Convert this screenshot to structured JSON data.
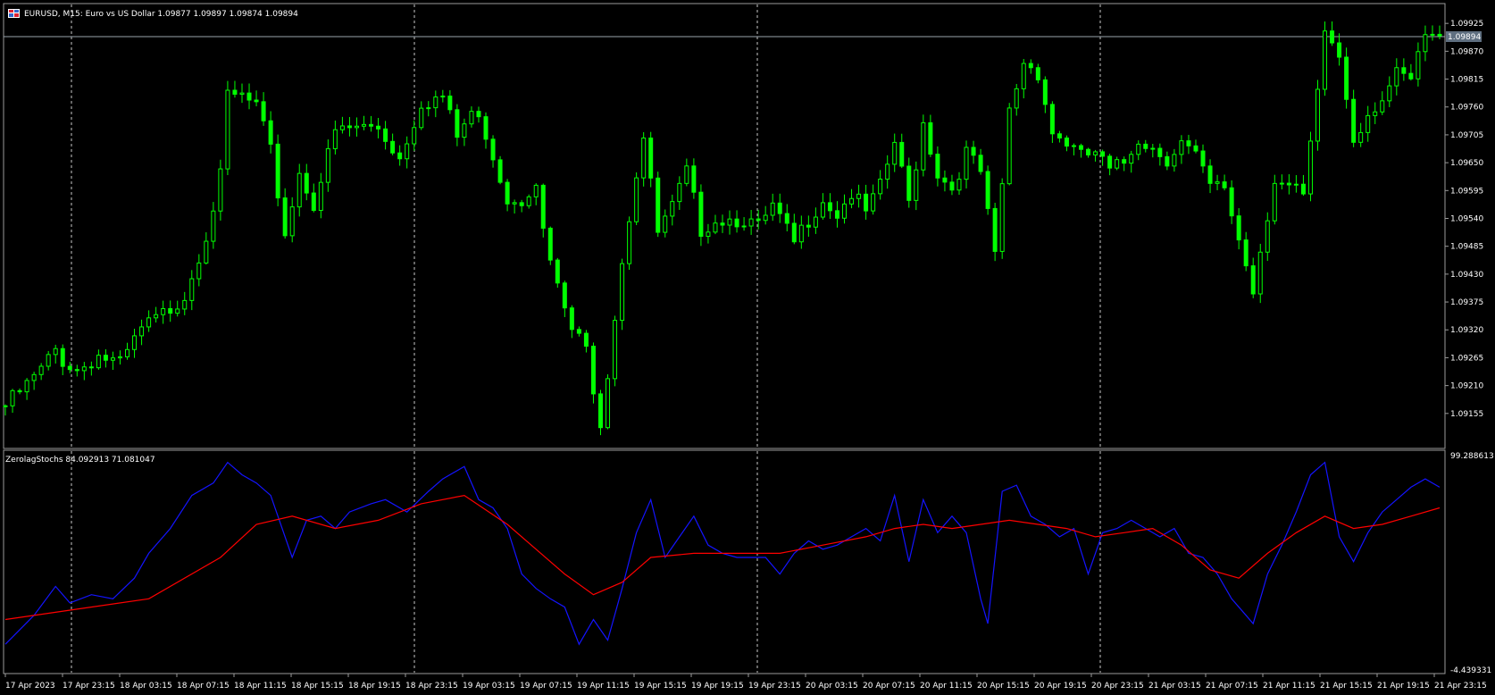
{
  "window": {
    "title": "EURUSD, M15:  Euro vs US Dollar  1.09877 1.09897 1.09874 1.09894",
    "indicator_title": "ZerolagStochs 84.092913 71.081047"
  },
  "colors": {
    "background": "#000000",
    "candle": "#00ff00",
    "grid": "#c8c8c8",
    "frame": "#9a9a9a",
    "bid_line": "#9aa3ad",
    "bid_label_bg": "#5f6f80",
    "stoch_main": "#1414ff",
    "stoch_signal": "#ff0000",
    "text": "#ffffff"
  },
  "icons": {
    "window_icon": "chart-window-icon"
  },
  "chart_data": [
    {
      "type": "candlestick",
      "symbol": "EURUSD",
      "timeframe": "M15",
      "ylim": [
        1.091,
        1.0995
      ],
      "y_ticks": [
        "1.09925",
        "1.09870",
        "1.09815",
        "1.09760",
        "1.09705",
        "1.09650",
        "1.09595",
        "1.09540",
        "1.09485",
        "1.09430",
        "1.09375",
        "1.09320",
        "1.09265",
        "1.09210",
        "1.09155"
      ],
      "current_price": "1.09894",
      "grid": "vertical-dashed",
      "x_ticks": [
        "17 Apr 2023",
        "17 Apr 23:15",
        "18 Apr 03:15",
        "18 Apr 07:15",
        "18 Apr 11:15",
        "18 Apr 15:15",
        "18 Apr 19:15",
        "18 Apr 23:15",
        "19 Apr 03:15",
        "19 Apr 07:15",
        "19 Apr 11:15",
        "19 Apr 15:15",
        "19 Apr 19:15",
        "19 Apr 23:15",
        "20 Apr 03:15",
        "20 Apr 07:15",
        "20 Apr 11:15",
        "20 Apr 15:15",
        "20 Apr 19:15",
        "20 Apr 23:15",
        "21 Apr 03:15",
        "21 Apr 07:15",
        "21 Apr 11:15",
        "21 Apr 15:15",
        "21 Apr 19:15",
        "21 Apr 23:15"
      ],
      "close_path": [
        [
          0,
          1.0917
        ],
        [
          3,
          1.0921
        ],
        [
          5,
          1.0924
        ],
        [
          7,
          1.0928
        ],
        [
          8,
          1.0926
        ],
        [
          10,
          1.0924
        ],
        [
          13,
          1.0927
        ],
        [
          16,
          1.0925
        ],
        [
          19,
          1.0932
        ],
        [
          22,
          1.0935
        ],
        [
          25,
          1.0939
        ],
        [
          28,
          1.0951
        ],
        [
          30,
          1.0962
        ],
        [
          31,
          1.0978
        ],
        [
          33,
          1.0978
        ],
        [
          35,
          1.0976
        ],
        [
          37,
          1.0967
        ],
        [
          39,
          1.0951
        ],
        [
          41,
          1.0963
        ],
        [
          43,
          1.0957
        ],
        [
          46,
          1.0971
        ],
        [
          49,
          1.0972
        ],
        [
          52,
          1.0972
        ],
        [
          55,
          1.0966
        ],
        [
          58,
          1.0977
        ],
        [
          61,
          1.0978
        ],
        [
          63,
          1.097
        ],
        [
          65,
          1.0975
        ],
        [
          67,
          1.0971
        ],
        [
          70,
          1.0958
        ],
        [
          72,
          1.0958
        ],
        [
          74,
          1.0962
        ],
        [
          75,
          1.0951
        ],
        [
          77,
          1.094
        ],
        [
          79,
          1.0932
        ],
        [
          81,
          1.0928
        ],
        [
          83,
          1.0914
        ],
        [
          84,
          1.0924
        ],
        [
          86,
          1.0946
        ],
        [
          88,
          1.0963
        ],
        [
          89,
          1.097
        ],
        [
          91,
          1.0951
        ],
        [
          93,
          1.0956
        ],
        [
          95,
          1.0963
        ],
        [
          97,
          1.0952
        ],
        [
          99,
          1.0954
        ],
        [
          101,
          1.0954
        ],
        [
          103,
          1.0954
        ],
        [
          105,
          1.0952
        ],
        [
          107,
          1.0956
        ],
        [
          110,
          1.0949
        ],
        [
          112,
          1.0954
        ],
        [
          114,
          1.0958
        ],
        [
          116,
          1.0955
        ],
        [
          118,
          1.0959
        ],
        [
          120,
          1.0955
        ],
        [
          122,
          1.096
        ],
        [
          124,
          1.0969
        ],
        [
          126,
          1.0957
        ],
        [
          128,
          1.0973
        ],
        [
          130,
          1.0963
        ],
        [
          132,
          1.096
        ],
        [
          134,
          1.0967
        ],
        [
          136,
          1.0963
        ],
        [
          138,
          1.0946
        ],
        [
          140,
          1.0975
        ],
        [
          142,
          1.0985
        ],
        [
          144,
          1.0983
        ],
        [
          146,
          1.0971
        ],
        [
          148,
          1.0969
        ],
        [
          150,
          1.0966
        ],
        [
          152,
          1.0967
        ],
        [
          154,
          1.0963
        ],
        [
          156,
          1.0965
        ],
        [
          158,
          1.097
        ],
        [
          160,
          1.0968
        ],
        [
          162,
          1.0966
        ],
        [
          164,
          1.0969
        ],
        [
          166,
          1.0966
        ],
        [
          168,
          1.096
        ],
        [
          170,
          1.096
        ],
        [
          172,
          1.095
        ],
        [
          174,
          1.094
        ],
        [
          175,
          1.0948
        ],
        [
          177,
          1.0962
        ],
        [
          179,
          1.096
        ],
        [
          181,
          1.0958
        ],
        [
          183,
          1.0978
        ],
        [
          184,
          1.0991
        ],
        [
          186,
          1.0986
        ],
        [
          188,
          1.097
        ],
        [
          190,
          1.0975
        ],
        [
          192,
          1.0978
        ],
        [
          194,
          1.0982
        ],
        [
          196,
          1.0981
        ],
        [
          198,
          1.099
        ],
        [
          200,
          1.0989
        ]
      ]
    },
    {
      "type": "line",
      "name": "ZerolagStochs",
      "ylim": [
        -4.439331,
        99.288613
      ],
      "y_ticks": [
        "99.288613",
        "-4.439331"
      ],
      "series": [
        {
          "values": [
            84.092913
          ],
          "points": [
            [
              0,
              8
            ],
            [
              4,
              22
            ],
            [
              7,
              36
            ],
            [
              9,
              28
            ],
            [
              12,
              32
            ],
            [
              15,
              30
            ],
            [
              18,
              40
            ],
            [
              20,
              52
            ],
            [
              23,
              64
            ],
            [
              26,
              80
            ],
            [
              29,
              86
            ],
            [
              31,
              96
            ],
            [
              33,
              90
            ],
            [
              35,
              86
            ],
            [
              37,
              80
            ],
            [
              40,
              50
            ],
            [
              42,
              68
            ],
            [
              44,
              70
            ],
            [
              46,
              64
            ],
            [
              48,
              72
            ],
            [
              51,
              76
            ],
            [
              53,
              78
            ],
            [
              56,
              72
            ],
            [
              59,
              82
            ],
            [
              61,
              88
            ],
            [
              64,
              94
            ],
            [
              66,
              78
            ],
            [
              68,
              74
            ],
            [
              70,
              64
            ],
            [
              72,
              42
            ],
            [
              74,
              35
            ],
            [
              76,
              30
            ],
            [
              78,
              26
            ],
            [
              80,
              8
            ],
            [
              82,
              20
            ],
            [
              84,
              10
            ],
            [
              86,
              35
            ],
            [
              88,
              62
            ],
            [
              90,
              78
            ],
            [
              92,
              50
            ],
            [
              94,
              60
            ],
            [
              96,
              70
            ],
            [
              98,
              56
            ],
            [
              100,
              52
            ],
            [
              102,
              50
            ],
            [
              104,
              50
            ],
            [
              106,
              50
            ],
            [
              108,
              42
            ],
            [
              110,
              52
            ],
            [
              112,
              58
            ],
            [
              114,
              54
            ],
            [
              116,
              56
            ],
            [
              118,
              60
            ],
            [
              120,
              64
            ],
            [
              122,
              58
            ],
            [
              124,
              80
            ],
            [
              126,
              48
            ],
            [
              128,
              78
            ],
            [
              130,
              62
            ],
            [
              132,
              70
            ],
            [
              134,
              62
            ],
            [
              136,
              30
            ],
            [
              137,
              18
            ],
            [
              139,
              82
            ],
            [
              141,
              85
            ],
            [
              143,
              70
            ],
            [
              145,
              66
            ],
            [
              147,
              60
            ],
            [
              149,
              64
            ],
            [
              151,
              42
            ],
            [
              153,
              62
            ],
            [
              155,
              64
            ],
            [
              157,
              68
            ],
            [
              159,
              64
            ],
            [
              161,
              60
            ],
            [
              163,
              64
            ],
            [
              165,
              52
            ],
            [
              167,
              50
            ],
            [
              169,
              42
            ],
            [
              171,
              30
            ],
            [
              173,
              22
            ],
            [
              174,
              18
            ],
            [
              176,
              42
            ],
            [
              178,
              56
            ],
            [
              180,
              72
            ],
            [
              182,
              90
            ],
            [
              184,
              96
            ],
            [
              186,
              60
            ],
            [
              188,
              48
            ],
            [
              190,
              62
            ],
            [
              192,
              72
            ],
            [
              194,
              78
            ],
            [
              196,
              84
            ],
            [
              198,
              88
            ],
            [
              200,
              84
            ]
          ]
        },
        {
          "values": [
            71.081047
          ],
          "points": [
            [
              0,
              20
            ],
            [
              10,
              25
            ],
            [
              20,
              30
            ],
            [
              30,
              50
            ],
            [
              35,
              66
            ],
            [
              40,
              70
            ],
            [
              46,
              64
            ],
            [
              52,
              68
            ],
            [
              58,
              76
            ],
            [
              64,
              80
            ],
            [
              70,
              66
            ],
            [
              74,
              54
            ],
            [
              78,
              42
            ],
            [
              82,
              32
            ],
            [
              86,
              38
            ],
            [
              90,
              50
            ],
            [
              96,
              52
            ],
            [
              102,
              52
            ],
            [
              108,
              52
            ],
            [
              114,
              56
            ],
            [
              120,
              60
            ],
            [
              124,
              64
            ],
            [
              128,
              66
            ],
            [
              132,
              64
            ],
            [
              136,
              66
            ],
            [
              140,
              68
            ],
            [
              144,
              66
            ],
            [
              148,
              64
            ],
            [
              152,
              60
            ],
            [
              156,
              62
            ],
            [
              160,
              64
            ],
            [
              164,
              56
            ],
            [
              168,
              44
            ],
            [
              172,
              40
            ],
            [
              176,
              52
            ],
            [
              180,
              62
            ],
            [
              184,
              70
            ],
            [
              188,
              64
            ],
            [
              192,
              66
            ],
            [
              196,
              70
            ],
            [
              200,
              74
            ]
          ]
        }
      ]
    }
  ]
}
